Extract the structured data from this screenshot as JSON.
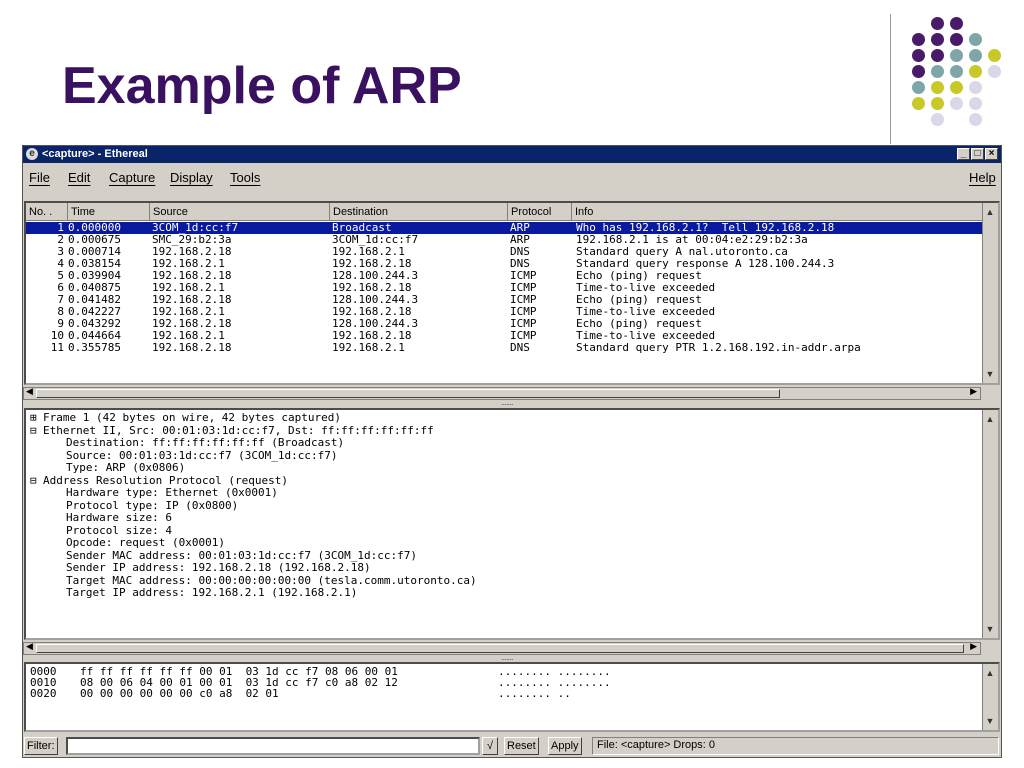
{
  "slide": {
    "title": "Example of ARP"
  },
  "colors": {
    "title": "#3a1060",
    "dot_purple": "#4a1a6a",
    "dot_teal": "#7fa6a6",
    "dot_yellow": "#c8c82a",
    "dot_lavender": "#d8d8e8",
    "selection": "#0a1a9e"
  },
  "window": {
    "title": "<capture> - Ethereal",
    "app_icon": "ethereal-icon",
    "controls": [
      "_",
      "□",
      "×"
    ],
    "menu": [
      "File",
      "Edit",
      "Capture",
      "Display",
      "Tools"
    ],
    "help": "Help"
  },
  "packet_list": {
    "columns": [
      "No. .",
      "Time",
      "Source",
      "Destination",
      "Protocol",
      "Info"
    ],
    "rows": [
      {
        "no": "1",
        "time": "0.000000",
        "source": "3COM_1d:cc:f7",
        "destination": "Broadcast",
        "protocol": "ARP",
        "info": "Who has 192.168.2.1?  Tell 192.168.2.18"
      },
      {
        "no": "2",
        "time": "0.000675",
        "source": "SMC_29:b2:3a",
        "destination": "3COM_1d:cc:f7",
        "protocol": "ARP",
        "info": "192.168.2.1 is at 00:04:e2:29:b2:3a"
      },
      {
        "no": "3",
        "time": "0.000714",
        "source": "192.168.2.18",
        "destination": "192.168.2.1",
        "protocol": "DNS",
        "info": "Standard query A nal.utoronto.ca"
      },
      {
        "no": "4",
        "time": "0.038154",
        "source": "192.168.2.1",
        "destination": "192.168.2.18",
        "protocol": "DNS",
        "info": "Standard query response A 128.100.244.3"
      },
      {
        "no": "5",
        "time": "0.039904",
        "source": "192.168.2.18",
        "destination": "128.100.244.3",
        "protocol": "ICMP",
        "info": "Echo (ping) request"
      },
      {
        "no": "6",
        "time": "0.040875",
        "source": "192.168.2.1",
        "destination": "192.168.2.18",
        "protocol": "ICMP",
        "info": "Time-to-live exceeded"
      },
      {
        "no": "7",
        "time": "0.041482",
        "source": "192.168.2.18",
        "destination": "128.100.244.3",
        "protocol": "ICMP",
        "info": "Echo (ping) request"
      },
      {
        "no": "8",
        "time": "0.042227",
        "source": "192.168.2.1",
        "destination": "192.168.2.18",
        "protocol": "ICMP",
        "info": "Time-to-live exceeded"
      },
      {
        "no": "9",
        "time": "0.043292",
        "source": "192.168.2.18",
        "destination": "128.100.244.3",
        "protocol": "ICMP",
        "info": "Echo (ping) request"
      },
      {
        "no": "10",
        "time": "0.044664",
        "source": "192.168.2.1",
        "destination": "192.168.2.18",
        "protocol": "ICMP",
        "info": "Time-to-live exceeded"
      },
      {
        "no": "11",
        "time": "0.355785",
        "source": "192.168.2.18",
        "destination": "192.168.2.1",
        "protocol": "DNS",
        "info": "Standard query PTR 1.2.168.192.in-addr.arpa"
      }
    ]
  },
  "details": [
    {
      "text": "Frame 1 (42 bytes on wire, 42 bytes captured)",
      "toggle": "⊞",
      "level": 0
    },
    {
      "text": "Ethernet II, Src: 00:01:03:1d:cc:f7, Dst: ff:ff:ff:ff:ff:ff",
      "toggle": "⊟",
      "level": 0
    },
    {
      "text": "Destination: ff:ff:ff:ff:ff:ff (Broadcast)",
      "toggle": "",
      "level": 1
    },
    {
      "text": "Source: 00:01:03:1d:cc:f7 (3COM_1d:cc:f7)",
      "toggle": "",
      "level": 1
    },
    {
      "text": "Type: ARP (0x0806)",
      "toggle": "",
      "level": 1
    },
    {
      "text": "Address Resolution Protocol (request)",
      "toggle": "⊟",
      "level": 0
    },
    {
      "text": "Hardware type: Ethernet (0x0001)",
      "toggle": "",
      "level": 1
    },
    {
      "text": "Protocol type: IP (0x0800)",
      "toggle": "",
      "level": 1
    },
    {
      "text": "Hardware size: 6",
      "toggle": "",
      "level": 1
    },
    {
      "text": "Protocol size: 4",
      "toggle": "",
      "level": 1
    },
    {
      "text": "Opcode: request (0x0001)",
      "toggle": "",
      "level": 1
    },
    {
      "text": "Sender MAC address: 00:01:03:1d:cc:f7 (3COM_1d:cc:f7)",
      "toggle": "",
      "level": 1
    },
    {
      "text": "Sender IP address: 192.168.2.18 (192.168.2.18)",
      "toggle": "",
      "level": 1
    },
    {
      "text": "Target MAC address: 00:00:00:00:00:00 (tesla.comm.utoronto.ca)",
      "toggle": "",
      "level": 1
    },
    {
      "text": "Target IP address: 192.168.2.1 (192.168.2.1)",
      "toggle": "",
      "level": 1
    }
  ],
  "hex": [
    {
      "offset": "0000",
      "bytes": "ff ff ff ff ff ff 00 01  03 1d cc f7 08 06 00 01",
      "ascii": "........ ........"
    },
    {
      "offset": "0010",
      "bytes": "08 00 06 04 00 01 00 01  03 1d cc f7 c0 a8 02 12",
      "ascii": "........ ........"
    },
    {
      "offset": "0020",
      "bytes": "00 00 00 00 00 00 c0 a8  02 01",
      "ascii": "........ .."
    }
  ],
  "filter": {
    "label": "Filter:",
    "value": "",
    "check": "√",
    "reset": "Reset",
    "apply": "Apply",
    "status": "File: <capture>  Drops: 0"
  },
  "icons": {
    "scroll_up": "scroll-up-icon",
    "scroll_down": "scroll-down-icon",
    "scroll_left": "scroll-left-icon",
    "scroll_right": "scroll-right-icon",
    "tree_toggle": "tree-toggle-icon"
  }
}
